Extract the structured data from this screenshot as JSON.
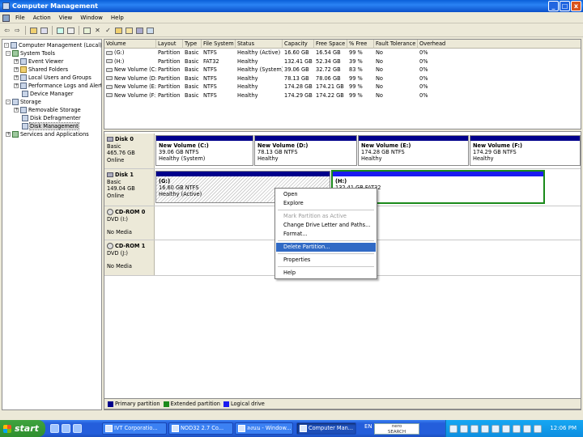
{
  "window": {
    "title": "Computer Management",
    "controls": [
      "_",
      "□",
      "x"
    ]
  },
  "menu": [
    "File",
    "Action",
    "View",
    "Window",
    "Help"
  ],
  "toolbar_icons": [
    "back-arrow-icon",
    "forward-arrow-icon",
    "up-folder-icon",
    "show-hide-tree-icon",
    "properties-icon",
    "refresh-icon",
    "delete-icon",
    "check-icon",
    "new-icon",
    "open-icon",
    "save-icon",
    "help-icon"
  ],
  "tree": {
    "root": "Computer Management (Local)",
    "system_tools": "System Tools",
    "event_viewer": "Event Viewer",
    "shared_folders": "Shared Folders",
    "local_users": "Local Users and Groups",
    "perf_logs": "Performance Logs and Alerts",
    "device_manager": "Device Manager",
    "storage": "Storage",
    "removable_storage": "Removable Storage",
    "disk_defrag": "Disk Defragmenter",
    "disk_mgmt": "Disk Management",
    "services": "Services and Applications"
  },
  "columns": [
    "Volume",
    "Layout",
    "Type",
    "File System",
    "Status",
    "Capacity",
    "Free Space",
    "% Free",
    "Fault Tolerance",
    "Overhead"
  ],
  "volumes": [
    [
      "(G:)",
      "Partition",
      "Basic",
      "NTFS",
      "Healthy (Active)",
      "16.60 GB",
      "16.54 GB",
      "99 %",
      "No",
      "0%"
    ],
    [
      "(H:)",
      "Partition",
      "Basic",
      "FAT32",
      "Healthy",
      "132.41 GB",
      "52.34 GB",
      "39 %",
      "No",
      "0%"
    ],
    [
      "New Volume (C:)",
      "Partition",
      "Basic",
      "NTFS",
      "Healthy (System)",
      "39.06 GB",
      "32.72 GB",
      "83 %",
      "No",
      "0%"
    ],
    [
      "New Volume (D:)",
      "Partition",
      "Basic",
      "NTFS",
      "Healthy",
      "78.13 GB",
      "78.06 GB",
      "99 %",
      "No",
      "0%"
    ],
    [
      "New Volume (E:)",
      "Partition",
      "Basic",
      "NTFS",
      "Healthy",
      "174.28 GB",
      "174.21 GB",
      "99 %",
      "No",
      "0%"
    ],
    [
      "New Volume (F:)",
      "Partition",
      "Basic",
      "NTFS",
      "Healthy",
      "174.29 GB",
      "174.22 GB",
      "99 %",
      "No",
      "0%"
    ]
  ],
  "disks": {
    "disk0": {
      "name": "Disk 0",
      "type": "Basic",
      "size": "465.76 GB",
      "status": "Online",
      "partitions": [
        {
          "name": "New Volume  (C:)",
          "size": "39.06 GB NTFS",
          "status": "Healthy (System)"
        },
        {
          "name": "New Volume  (D:)",
          "size": "78.13 GB NTFS",
          "status": "Healthy"
        },
        {
          "name": "New Volume  (E:)",
          "size": "174.28 GB NTFS",
          "status": "Healthy"
        },
        {
          "name": "New Volume  (F:)",
          "size": "174.29 GB NTFS",
          "status": "Healthy"
        }
      ]
    },
    "disk1": {
      "name": "Disk 1",
      "type": "Basic",
      "size": "149.04 GB",
      "status": "Online",
      "partitions": [
        {
          "name": "(G:)",
          "size": "16.60 GB NTFS",
          "status": "Healthy (Active)"
        },
        {
          "name": "(H:)",
          "size": "132.41 GB FAT32",
          "status": ""
        }
      ]
    },
    "cdrom0": {
      "name": "CD-ROM 0",
      "drive": "DVD (I:)",
      "media": "No Media"
    },
    "cdrom1": {
      "name": "CD-ROM 1",
      "drive": "DVD (J:)",
      "media": "No Media"
    }
  },
  "legend": [
    {
      "label": "Primary partition",
      "color": "#00008b"
    },
    {
      "label": "Extended partition",
      "color": "#1a8a1a"
    },
    {
      "label": "Logical drive",
      "color": "#1b1bf0"
    }
  ],
  "context_menu": {
    "open": "Open",
    "explore": "Explore",
    "mark_active": "Mark Partition as Active",
    "change_letter": "Change Drive Letter and Paths...",
    "format": "Format...",
    "delete": "Delete Partition...",
    "properties": "Properties",
    "help": "Help"
  },
  "taskbar": {
    "start": "start",
    "tasks": [
      "IVT Corporatio...",
      "NOD32 2.7 Co...",
      "ลงนน - Window...",
      "Computer Man..."
    ],
    "lang": "EN",
    "nero_top": "nero",
    "nero_bottom": "SEARCH",
    "clock": "12:06 PM"
  }
}
